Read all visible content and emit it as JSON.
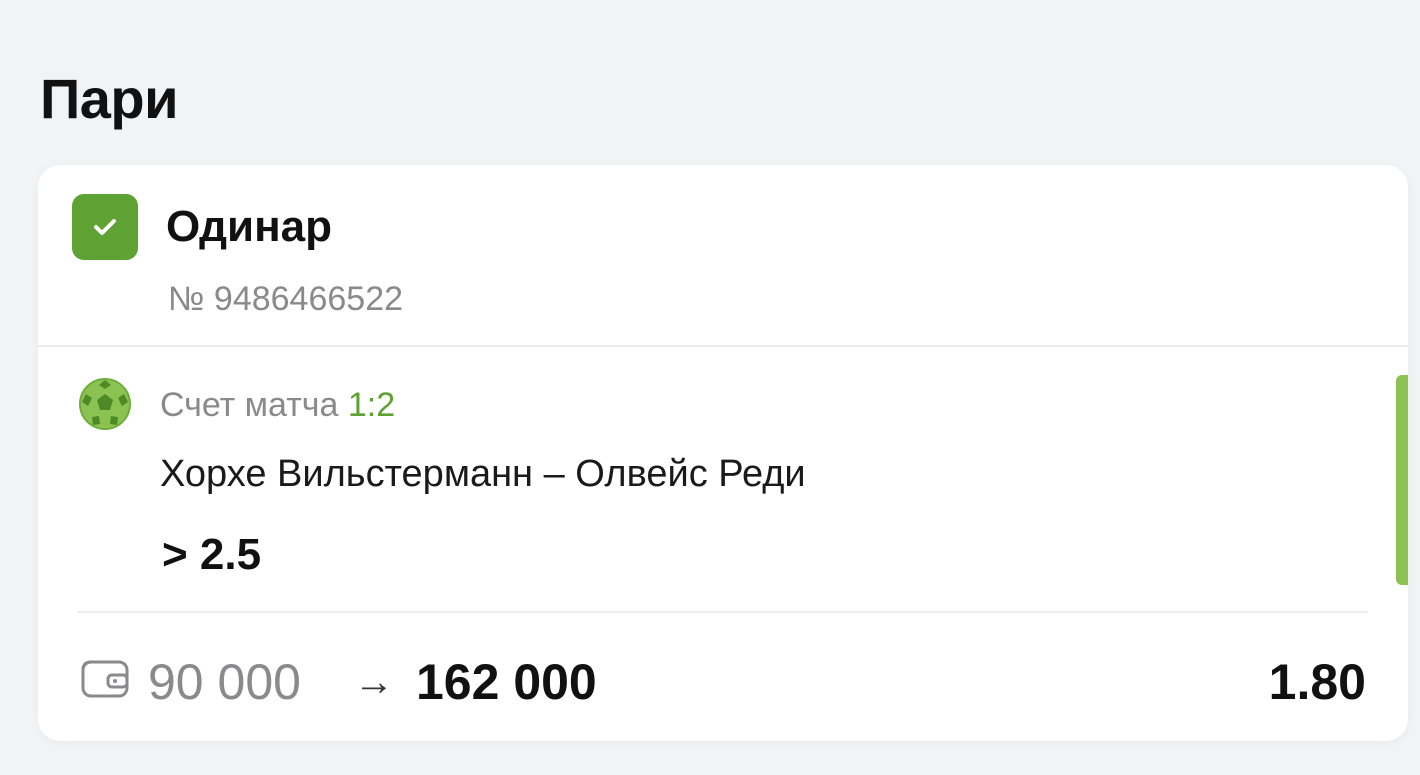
{
  "page": {
    "title": "Пари"
  },
  "bet": {
    "type": "Одинар",
    "number": "№ 9486466522",
    "status_icon": "check-icon",
    "accent_color": "#5ea233",
    "event": {
      "sport_icon": "football-icon",
      "score_label": "Счет матча",
      "score_value": "1:2",
      "match": "Хорхе Вильстерманн – Олвейс Реди",
      "outcome": "> 2.5"
    },
    "footer": {
      "wallet_icon": "wallet-icon",
      "stake": "90 000",
      "arrow": "→",
      "payout": "162 000",
      "odds": "1.80"
    }
  }
}
